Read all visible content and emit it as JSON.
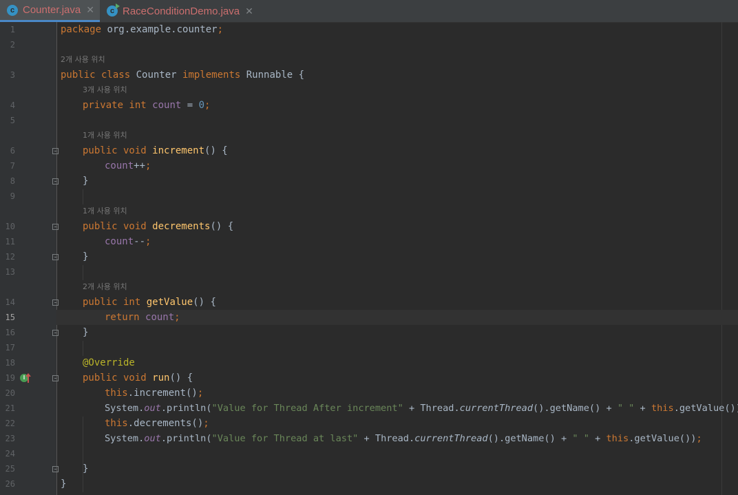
{
  "tabs": [
    {
      "label": "Counter.java",
      "icon": "java-class-icon",
      "active": true
    },
    {
      "label": "RaceConditionDemo.java",
      "icon": "java-class-runnable-icon",
      "active": false
    }
  ],
  "editor": {
    "current_line": "15",
    "usage_hints": {
      "class": "2개 사용 위치",
      "count": "3개 사용 위치",
      "increment": "1개 사용 위치",
      "decrements": "1개 사용 위치",
      "getValue": "2개 사용 위치"
    },
    "line_numbers": [
      "1",
      "2",
      "3",
      "4",
      "5",
      "6",
      "7",
      "8",
      "9",
      "10",
      "11",
      "12",
      "13",
      "14",
      "15",
      "16",
      "17",
      "18",
      "19",
      "20",
      "21",
      "22",
      "23",
      "24",
      "25",
      "26"
    ],
    "code": {
      "l1": [
        "package",
        " org.example.counter",
        ";"
      ],
      "l3": [
        "public class",
        " Counter ",
        "implements",
        " Runnable {"
      ],
      "l4": [
        "private int",
        " ",
        "count",
        " = ",
        "0",
        ";"
      ],
      "l6": [
        "public void",
        " ",
        "increment",
        "() {"
      ],
      "l7": [
        "count",
        "++",
        ";"
      ],
      "l8": [
        "}"
      ],
      "l10": [
        "public void",
        " ",
        "decrements",
        "() {"
      ],
      "l11": [
        "count",
        "--",
        ";"
      ],
      "l12": [
        "}"
      ],
      "l14": [
        "public int",
        " ",
        "getValue",
        "() {"
      ],
      "l15": [
        "return",
        " ",
        "count",
        ";"
      ],
      "l16": [
        "}"
      ],
      "l18": [
        "@Override"
      ],
      "l19": [
        "public void",
        " ",
        "run",
        "() {"
      ],
      "l20": [
        "this",
        ".increment()",
        ";"
      ],
      "l21": [
        "System.",
        "out",
        ".println(",
        "\"Value for Thread After increment\"",
        " + Thread.",
        "currentThread",
        "().getName() + ",
        "\" \"",
        " + ",
        "this",
        ".getValue())",
        ";"
      ],
      "l22": [
        "this",
        ".decrements()",
        ";"
      ],
      "l23": [
        "System.",
        "out",
        ".println(",
        "\"Value for Thread at last\"",
        " + Thread.",
        "currentThread",
        "().getName() + ",
        "\" \"",
        " + ",
        "this",
        ".getValue())",
        ";"
      ],
      "l25": [
        "}"
      ],
      "l26": [
        "}"
      ]
    }
  },
  "colors": {
    "background": "#2b2b2b",
    "keyword": "#cc7832",
    "method": "#ffc66d",
    "field": "#9876aa",
    "number": "#6897bb",
    "string": "#6a8759",
    "annotation": "#bbb529",
    "text": "#a9b7c6"
  }
}
